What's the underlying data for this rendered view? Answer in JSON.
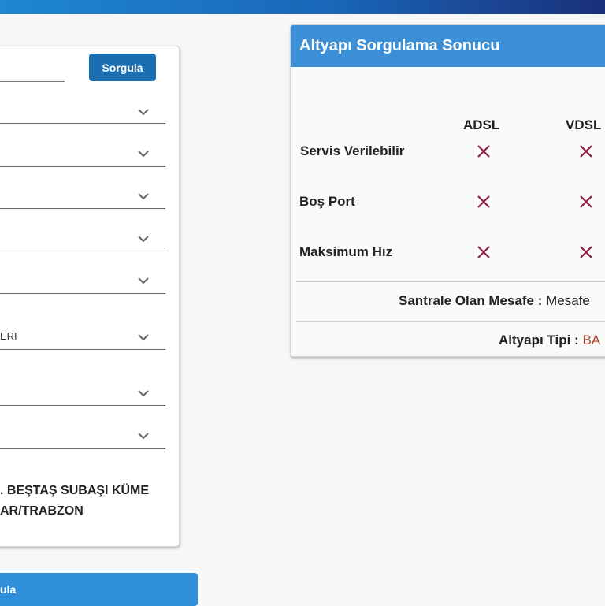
{
  "form": {
    "search_button": "Sorgula",
    "selects": [
      {
        "value": ""
      },
      {
        "value": ""
      },
      {
        "value": ""
      },
      {
        "value": ""
      },
      {
        "value": ""
      },
      {
        "value": "ERI"
      },
      {
        "value": ""
      },
      {
        "value": ""
      }
    ],
    "address_line1": ". BEŞTAŞ SUBAŞI KÜME",
    "address_line2": "AR/TRABZON",
    "bottom_button": "ula"
  },
  "result": {
    "title": "Altyapı Sorgulama Sonucu",
    "columns": [
      "ADSL",
      "VDSL"
    ],
    "rows": [
      {
        "label": "Servis Verilebilir",
        "values": [
          "no",
          "no"
        ]
      },
      {
        "label": "Boş Port",
        "values": [
          "no",
          "no"
        ]
      },
      {
        "label": "Maksimum Hız",
        "values": [
          "no",
          "no"
        ]
      }
    ],
    "distance_label": "Santrale Olan Mesafe :",
    "distance_value": "Mesafe",
    "type_label": "Altyapı Tipi :",
    "type_value": "BA"
  },
  "colors": {
    "header_blue": "#3a8fd6",
    "button_blue": "#1b6fb0",
    "x_color": "#8b1e4a"
  },
  "icons": {
    "select_arrow": "chevron-down-icon",
    "unavailable": "x-mark-icon"
  }
}
